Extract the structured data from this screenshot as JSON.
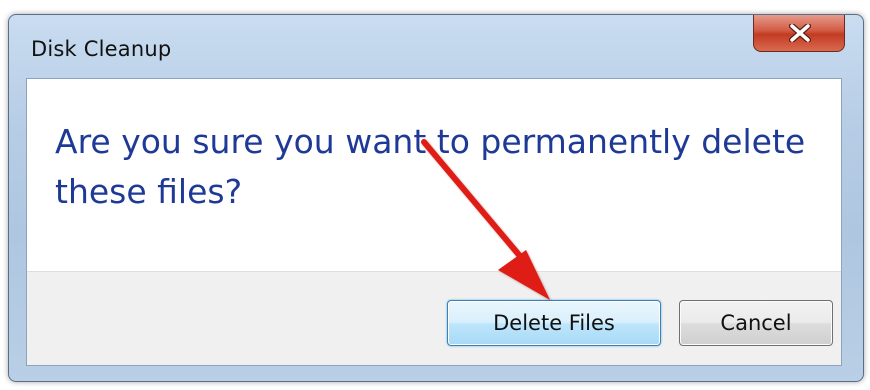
{
  "window": {
    "title": "Disk Cleanup"
  },
  "dialog": {
    "message": "Are you sure you want to permanently delete these files?",
    "buttons": {
      "delete_label": "Delete Files",
      "cancel_label": "Cancel"
    }
  },
  "annotation": {
    "arrow_color": "#e01b12",
    "icon": "red-arrow-icon"
  },
  "icons": {
    "close": "close-icon"
  },
  "colors": {
    "message_text": "#1e3a96",
    "close_button": "#c23b23",
    "default_button_border": "#3c7fb1"
  }
}
